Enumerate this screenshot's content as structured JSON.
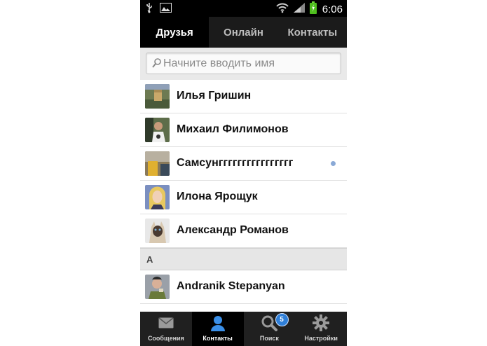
{
  "status_bar": {
    "time": "6:06",
    "icons": [
      "usb-icon",
      "image-icon",
      "wifi-icon",
      "signal-icon",
      "battery-icon"
    ]
  },
  "tabs": [
    {
      "label": "Друзья",
      "active": true
    },
    {
      "label": "Онлайн",
      "active": false
    },
    {
      "label": "Контакты",
      "active": false
    }
  ],
  "search": {
    "placeholder": "Начните вводить имя",
    "value": ""
  },
  "friends": [
    {
      "name": "Илья Гришин",
      "online": false
    },
    {
      "name": "Михаил Филимонов",
      "online": false
    },
    {
      "name": "Самсунгггггггггггггггг",
      "online": true
    },
    {
      "name": "Илона Ярощук",
      "online": false
    },
    {
      "name": "Александр Романов",
      "online": false
    }
  ],
  "section": {
    "label": "A"
  },
  "section_friends": [
    {
      "name": "Andranik Stepanyan",
      "online": false
    }
  ],
  "bottom_nav": [
    {
      "label": "Сообщения",
      "icon": "envelope-icon",
      "active": false
    },
    {
      "label": "Контакты",
      "icon": "person-icon",
      "active": true
    },
    {
      "label": "Поиск",
      "icon": "search-icon",
      "active": false,
      "badge": "5"
    },
    {
      "label": "Настройки",
      "icon": "gear-icon",
      "active": false
    }
  ],
  "colors": {
    "online_dot": "#8aa9d6",
    "badge": "#2f7fd8",
    "active_accent": "#3a8fe8"
  }
}
